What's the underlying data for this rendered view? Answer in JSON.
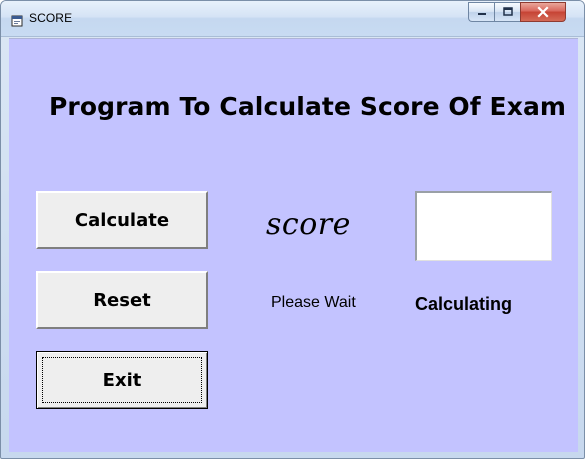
{
  "window": {
    "title": "SCORE",
    "icon": "vb-form-icon",
    "controls": {
      "minimize_icon": "minimize-icon",
      "maximize_icon": "maximize-icon",
      "close_icon": "close-icon"
    }
  },
  "form": {
    "heading": "Program To Calculate Score Of Exam",
    "score_label": "score",
    "score_value": "",
    "status": {
      "please_wait": "Please Wait",
      "calculating": "Calculating"
    },
    "buttons": {
      "calculate": "Calculate",
      "reset": "Reset",
      "exit": "Exit"
    }
  },
  "colors": {
    "client_background": "#c3c3ff",
    "button_face": "#eeeeee",
    "titlebar": "#d5e3f5",
    "close_button": "#c64334"
  }
}
